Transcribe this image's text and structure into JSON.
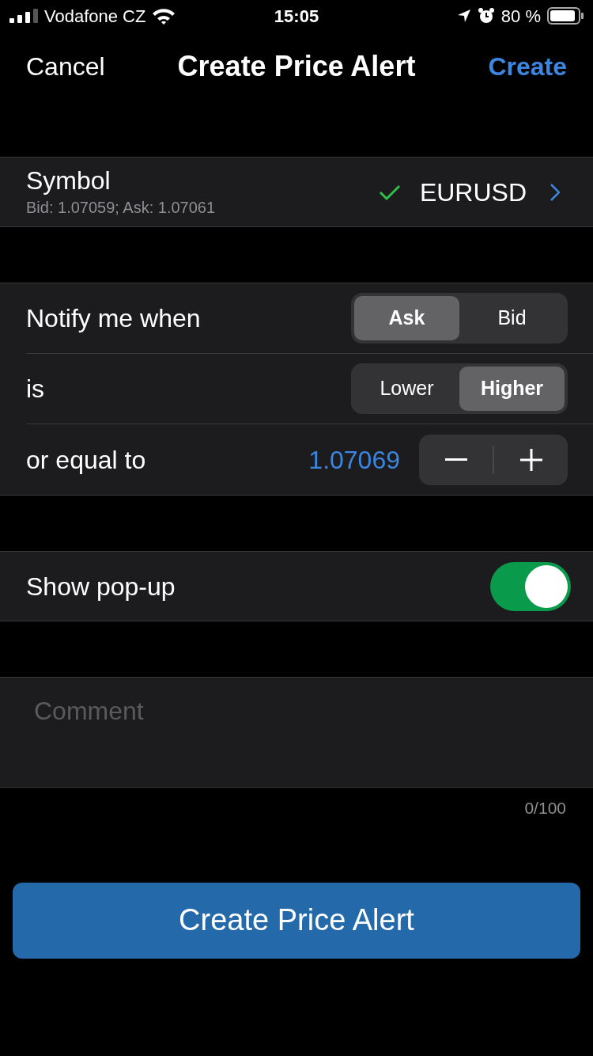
{
  "status_bar": {
    "carrier": "Vodafone CZ",
    "time": "15:05",
    "battery": "80 %"
  },
  "nav": {
    "cancel": "Cancel",
    "title": "Create Price Alert",
    "action": "Create"
  },
  "symbol": {
    "label": "Symbol",
    "quote": "Bid: 1.07059; Ask: 1.07061",
    "value": "EURUSD",
    "valid": true
  },
  "notify": {
    "label": "Notify me when",
    "options": [
      {
        "label": "Ask",
        "selected": true
      },
      {
        "label": "Bid",
        "selected": false
      }
    ]
  },
  "direction": {
    "label": "is",
    "options": [
      {
        "label": "Lower",
        "selected": false
      },
      {
        "label": "Higher",
        "selected": true
      }
    ]
  },
  "threshold": {
    "label": "or equal to",
    "value": "1.07069"
  },
  "popup": {
    "label": "Show pop-up",
    "on": true
  },
  "comment": {
    "placeholder": "Comment",
    "counter": "0/100"
  },
  "submit": {
    "label": "Create Price Alert"
  }
}
